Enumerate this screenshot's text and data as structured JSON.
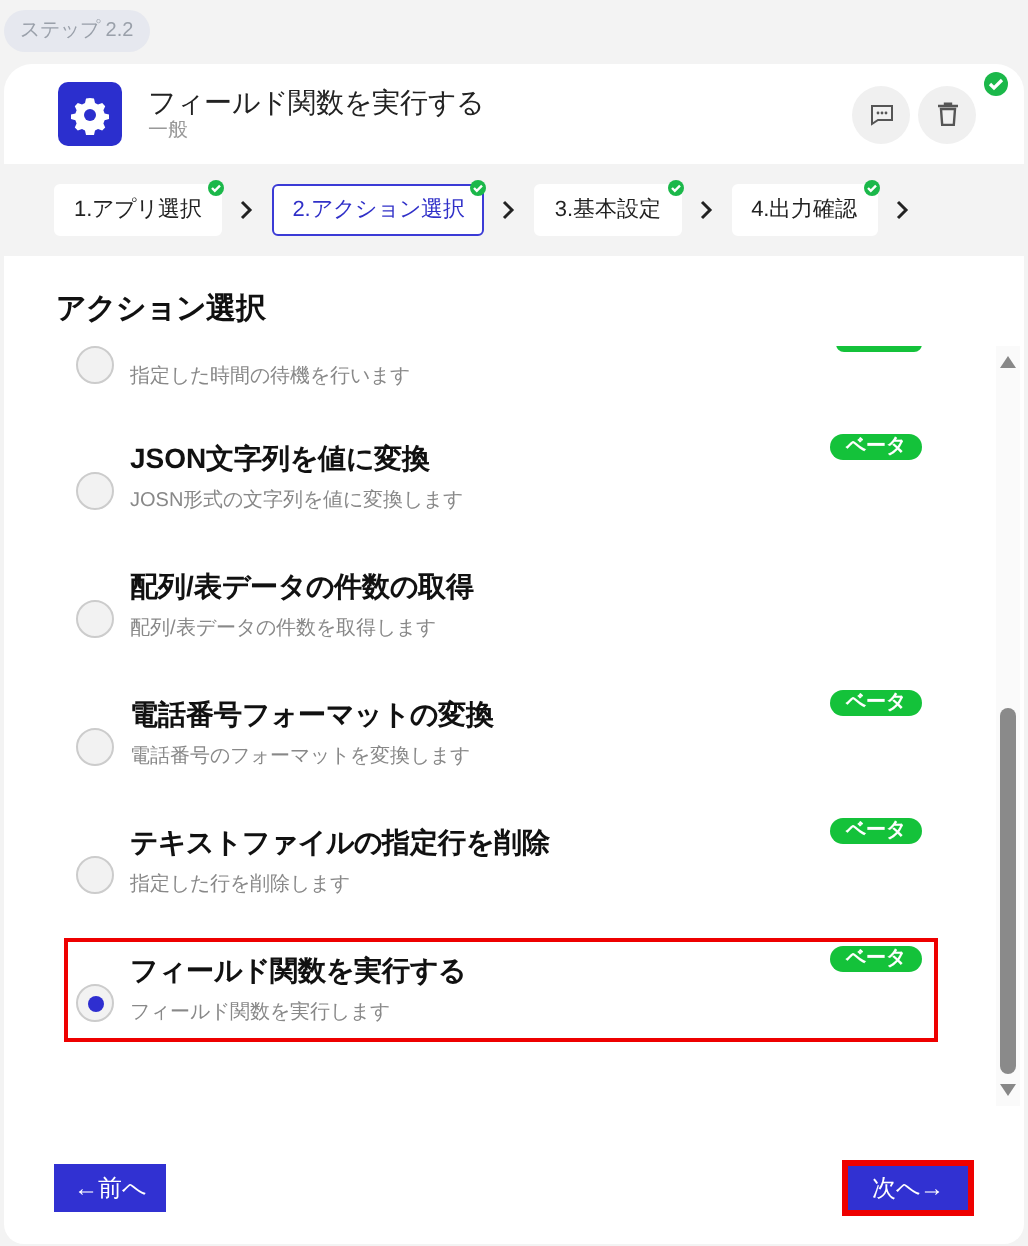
{
  "step_badge": "ステップ 2.2",
  "header": {
    "title": "フィールド関数を実行する",
    "subtitle": "一般",
    "completed": true
  },
  "steps": [
    {
      "label": "1.アプリ選択",
      "selected": false,
      "done": true
    },
    {
      "label": "2.アクション選択",
      "selected": true,
      "done": true
    },
    {
      "label": "3.基本設定",
      "selected": false,
      "done": true
    },
    {
      "label": "4.出力確認",
      "selected": false,
      "done": true
    }
  ],
  "section_title": "アクション選択",
  "actions": [
    {
      "kind": "clipped",
      "description": "指定した時間の待機を行います",
      "selected": false,
      "highlighted": false,
      "beta": true
    },
    {
      "kind": "full",
      "title": "JSON文字列を値に変換",
      "description": "JOSN形式の文字列を値に変換します",
      "badge": "ベータ",
      "selected": false,
      "highlighted": false
    },
    {
      "kind": "full",
      "title": "配列/表データの件数の取得",
      "description": "配列/表データの件数を取得します",
      "selected": false,
      "highlighted": false
    },
    {
      "kind": "full",
      "title": "電話番号フォーマットの変換",
      "description": "電話番号のフォーマットを変換します",
      "badge": "ベータ",
      "selected": false,
      "highlighted": false
    },
    {
      "kind": "full",
      "title": "テキストファイルの指定行を削除",
      "description": "指定した行を削除します",
      "badge": "ベータ",
      "selected": false,
      "highlighted": false
    },
    {
      "kind": "full",
      "title": "フィールド関数を実行する",
      "description": "フィールド関数を実行します",
      "badge": "ベータ",
      "selected": true,
      "highlighted": true
    }
  ],
  "prev_button": {
    "label": "←前へ",
    "highlighted": false
  },
  "next_button": {
    "label": "次へ→",
    "highlighted": true
  }
}
